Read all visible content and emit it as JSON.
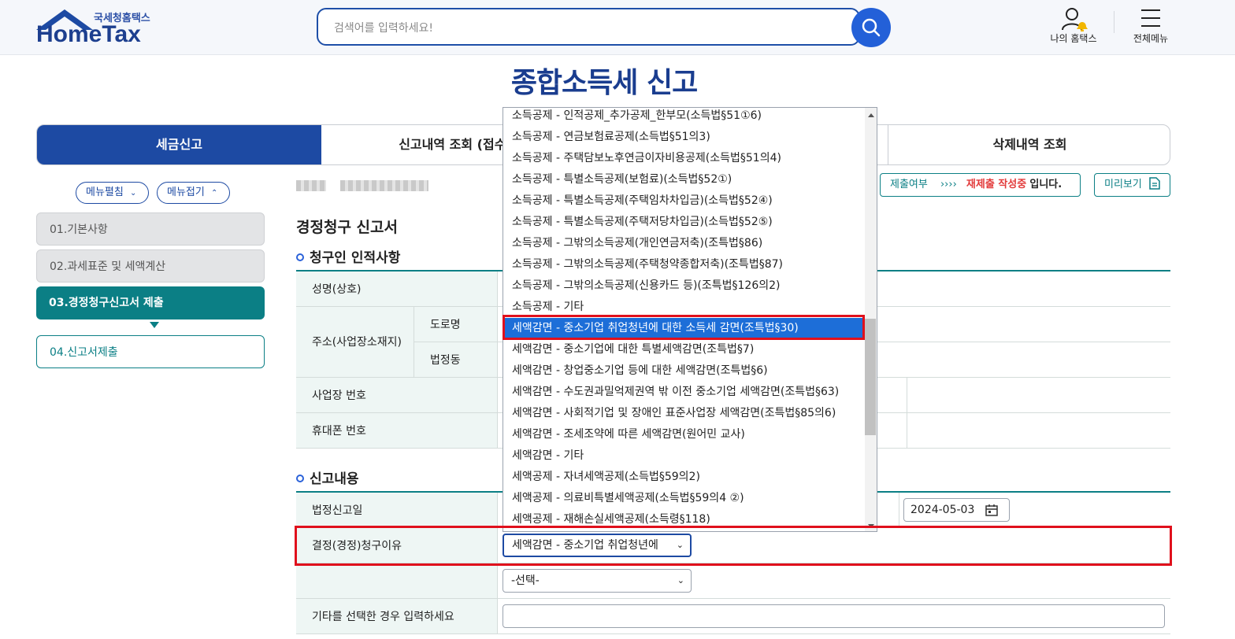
{
  "header": {
    "logo_sub": "국세청홈택스",
    "logo_main": "HomeTax",
    "search_placeholder": "검색어를 입력하세요!",
    "my_hometax": "나의 홈택스",
    "all_menu": "전체메뉴"
  },
  "page_title": "종합소득세 신고",
  "tabs": [
    "세금신고",
    "신고내역 조회 (접수증 ·",
    "삭제내역 조회"
  ],
  "left_menu": {
    "expand": "메뉴펼침",
    "collapse": "메뉴접기",
    "steps": [
      "01.기본사항",
      "02.과세표준 및 세액계산",
      "03.경정청구신고서 제출",
      "04.신고서제출"
    ]
  },
  "status": {
    "label": "제출여부",
    "arrows": "››››",
    "state": "재제출 작성중",
    "suffix": "입니다.",
    "preview": "미리보기"
  },
  "form": {
    "title": "경정청구 신고서",
    "section1": "청구인 인적사항",
    "name_label": "성명(상호)",
    "address_label": "주소(사업장소재지)",
    "road_label": "도로명",
    "lot_label": "법정동",
    "biz_no_label": "사업장 번호",
    "phone_label": "휴대폰 번호",
    "section2": "신고내용",
    "filing_date_label": "법정신고일",
    "filing_date": "2024-05-03",
    "reason_label": "결정(경정)청구이유",
    "reason_value": "세액감면 - 중소기업 취업청년에",
    "reason2_value": "-선택-",
    "other_label": "기타를 선택한 경우 입력하세요"
  },
  "dropdown": {
    "selected_index": 10,
    "options": [
      "소득공제 - 인적공제_추가공제_한부모(소득법§51①6)",
      "소득공제 - 연금보험료공제(소득법§51의3)",
      "소득공제 - 주택담보노후연금이자비용공제(소득법§51의4)",
      "소득공제 - 특별소득공제(보험료)(소득법§52①)",
      "소득공제 - 특별소득공제(주택임차차입금)(소득법§52④)",
      "소득공제 - 특별소득공제(주택저당차입금)(소득법§52⑤)",
      "소득공제 - 그밖의소득공제(개인연금저축)(조특법§86)",
      "소득공제 - 그밖의소득공제(주택청약종합저축)(조특법§87)",
      "소득공제 - 그밖의소득공제(신용카드 등)(조특법§126의2)",
      "소득공제 - 기타",
      "세액감면 - 중소기업 취업청년에 대한 소득세 감면(조특법§30)",
      "세액감면 - 중소기업에 대한 특별세액감면(조특법§7)",
      "세액감면 - 창업중소기업 등에 대한 세액감면(조특법§6)",
      "세액감면 - 수도권과밀억제권역 밖 이전 중소기업 세액감면(조특법§63)",
      "세액감면 - 사회적기업 및 장애인 표준사업장 세액감면(조특법§85의6)",
      "세액감면 - 조세조약에 따른 세액감면(원어민 교사)",
      "세액감면 - 기타",
      "세액공제 - 자녀세액공제(소득법§59의2)",
      "세액공제 - 의료비특별세액공제(소득법§59의4 ②)",
      "세액공제 - 재해손실세액공제(소득령§118)"
    ]
  }
}
